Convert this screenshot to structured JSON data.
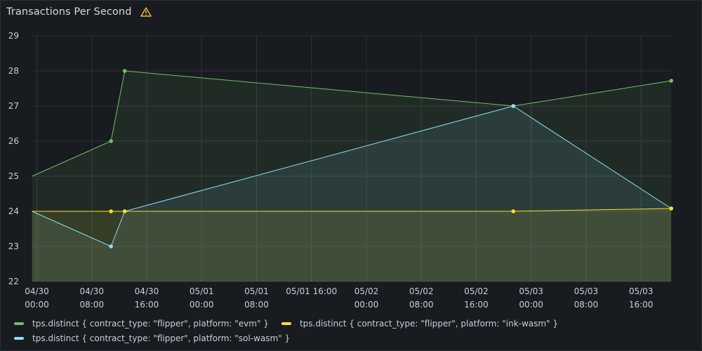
{
  "panel": {
    "title": "Transactions Per Second",
    "warning_icon": "warning-triangle-icon",
    "warning_color": "#f5b73d"
  },
  "chart_data": {
    "type": "line",
    "title": "Transactions Per Second",
    "xlabel": "",
    "ylabel": "",
    "ylim": [
      22,
      29
    ],
    "yticks": [
      22,
      23,
      24,
      25,
      26,
      27,
      28,
      29
    ],
    "x_ticks": [
      [
        "04/30",
        "00:00"
      ],
      [
        "04/30",
        "08:00"
      ],
      [
        "04/30",
        "16:00"
      ],
      [
        "05/01",
        "00:00"
      ],
      [
        "05/01",
        "08:00"
      ],
      [
        "05/01 16:00",
        ""
      ],
      [
        "05/02",
        "00:00"
      ],
      [
        "05/02",
        "08:00"
      ],
      [
        "05/02",
        "16:00"
      ],
      [
        "05/03",
        "00:00"
      ],
      [
        "05/03",
        "08:00"
      ],
      [
        "05/03",
        "16:00"
      ]
    ],
    "x_unit": "hours from 04/30 00:00",
    "xlim": [
      -0.7,
      92.4
    ],
    "grid": true,
    "legend_position": "bottom",
    "series": [
      {
        "name": "tps.distinct { contract_type: \"flipper\", platform: \"evm\" }",
        "color": "#73bf69",
        "x": [
          -0.7,
          10.8,
          12.8,
          69.4,
          92.4
        ],
        "values": [
          25,
          26,
          28,
          27,
          27.72
        ]
      },
      {
        "name": "tps.distinct { contract_type: \"flipper\", platform: \"ink-wasm\" }",
        "color": "#fade2a",
        "x": [
          -0.7,
          10.8,
          12.8,
          69.4,
          92.4
        ],
        "values": [
          24,
          24,
          24,
          24,
          24.08
        ]
      },
      {
        "name": "tps.distinct { contract_type: \"flipper\", platform: \"sol-wasm\" }",
        "color": "#8ae1f6",
        "x": [
          -0.7,
          10.8,
          12.8,
          69.4,
          92.4
        ],
        "values": [
          24,
          23,
          24,
          27,
          24.08
        ]
      }
    ]
  }
}
